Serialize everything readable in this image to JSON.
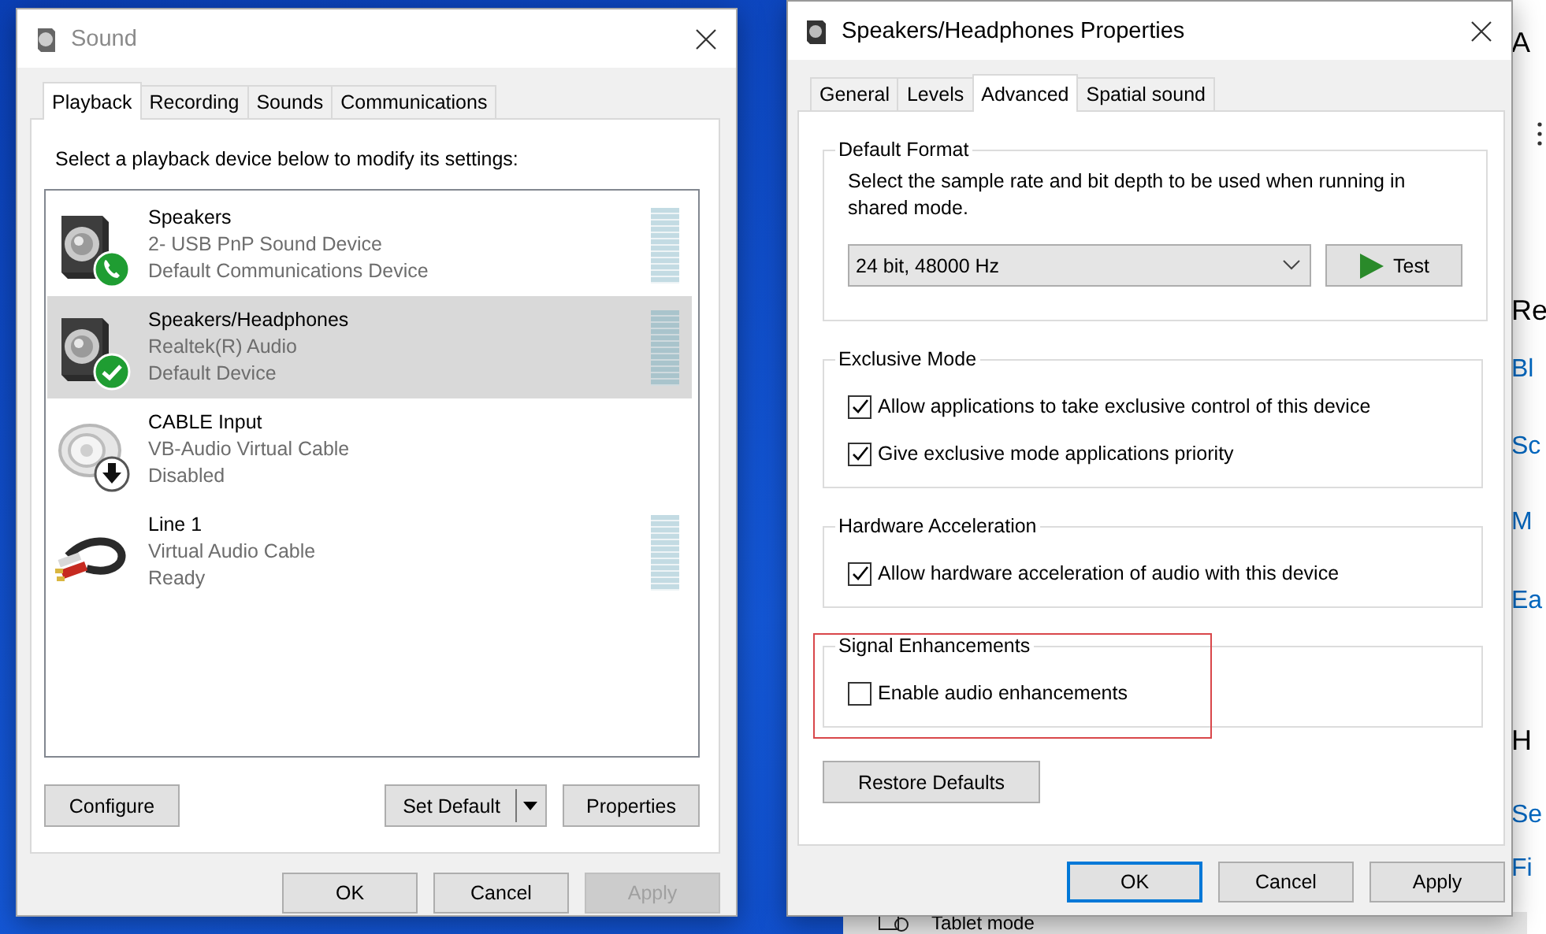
{
  "background_window": {
    "texts": [
      {
        "text": "A",
        "kind": "heading"
      },
      {
        "text": "Re",
        "kind": "heading"
      },
      {
        "text": "Bl",
        "kind": "link"
      },
      {
        "text": "Sc",
        "kind": "link"
      },
      {
        "text": "M",
        "kind": "link"
      },
      {
        "text": "Ea",
        "kind": "link"
      },
      {
        "text": "H",
        "kind": "heading"
      },
      {
        "text": "Se",
        "kind": "link"
      },
      {
        "text": "Fi",
        "kind": "link"
      }
    ],
    "bottom_item": "Tablet mode"
  },
  "sound_dialog": {
    "title": "Sound",
    "tabs": [
      {
        "label": "Playback",
        "selected": true
      },
      {
        "label": "Recording",
        "selected": false
      },
      {
        "label": "Sounds",
        "selected": false
      },
      {
        "label": "Communications",
        "selected": false
      }
    ],
    "instruction": "Select a playback device below to modify its settings:",
    "devices": [
      {
        "name": "Speakers",
        "description": "2- USB PnP Sound Device",
        "status": "Default Communications Device",
        "kind": "speaker",
        "badge": {
          "kind": "phone"
        },
        "meter": true,
        "selected": false
      },
      {
        "name": "Speakers/Headphones",
        "description": "Realtek(R) Audio",
        "status": "Default Device",
        "kind": "speaker",
        "badge": {
          "kind": "check"
        },
        "meter": true,
        "selected": true
      },
      {
        "name": "CABLE Input",
        "description": "VB-Audio Virtual Cable",
        "status": "Disabled",
        "kind": "disabled-speaker",
        "badge": {
          "kind": "arrow"
        },
        "meter": false,
        "selected": false
      },
      {
        "name": "Line 1",
        "description": "Virtual Audio Cable",
        "status": "Ready",
        "kind": "cable",
        "meter": true,
        "selected": false
      }
    ],
    "configure_button": "Configure",
    "set_default_button": "Set Default",
    "properties_button": "Properties",
    "footer_buttons": [
      {
        "label": "OK",
        "disabled": false
      },
      {
        "label": "Cancel",
        "disabled": false
      },
      {
        "label": "Apply",
        "disabled": true
      }
    ]
  },
  "properties_dialog": {
    "title": "Speakers/Headphones Properties",
    "tabs": [
      {
        "label": "General",
        "selected": false
      },
      {
        "label": "Levels",
        "selected": false
      },
      {
        "label": "Advanced",
        "selected": true
      },
      {
        "label": "Spatial sound",
        "selected": false
      }
    ],
    "groups": [
      {
        "title": "Default Format",
        "kind": "format",
        "highlighted": false,
        "description": "Select the sample rate and bit depth to be used when running in shared mode.",
        "format": "24 bit, 48000 Hz",
        "test_button": "Test"
      },
      {
        "title": "Exclusive Mode",
        "kind": "options",
        "highlighted": false,
        "options": [
          {
            "label": "Allow applications to take exclusive control of this device",
            "checked": true
          },
          {
            "label": "Give exclusive mode applications priority",
            "checked": true
          }
        ]
      },
      {
        "title": "Hardware Acceleration",
        "kind": "options",
        "highlighted": false,
        "options": [
          {
            "label": "Allow hardware acceleration of audio with this device",
            "checked": true
          }
        ]
      },
      {
        "title": "Signal Enhancements",
        "kind": "options",
        "highlighted": true,
        "options": [
          {
            "label": "Enable audio enhancements",
            "checked": false
          }
        ]
      }
    ],
    "restore_button": "Restore Defaults",
    "footer_buttons": [
      {
        "label": "OK",
        "default": true
      },
      {
        "label": "Cancel",
        "default": false
      },
      {
        "label": "Apply",
        "default": false
      }
    ]
  }
}
